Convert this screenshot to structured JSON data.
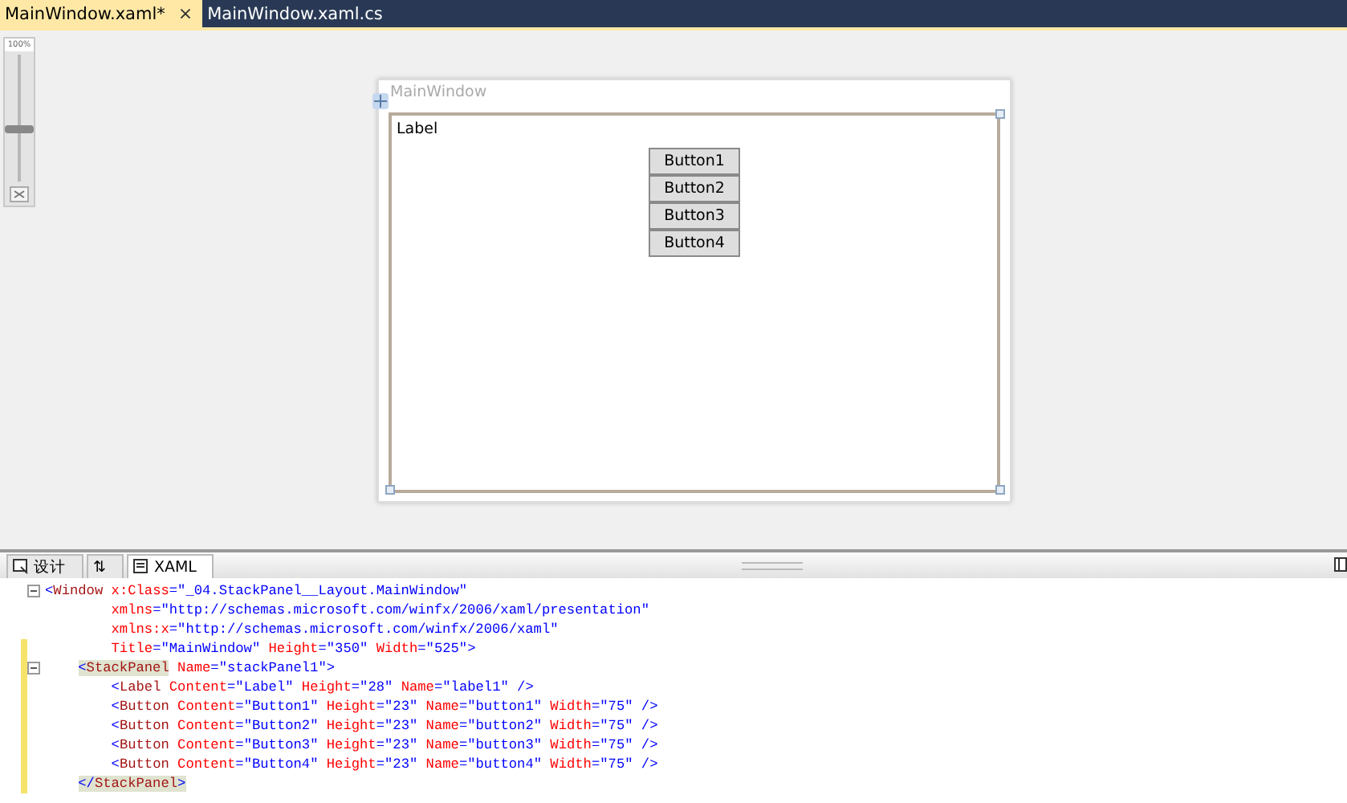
{
  "document_tabs": [
    {
      "label": "MainWindow.xaml*",
      "selected": true,
      "close": "×"
    },
    {
      "label": "MainWindow.xaml.cs",
      "selected": false
    }
  ],
  "zoom_slider": {
    "label": "100%",
    "level": 0.4
  },
  "designer": {
    "window_title": "MainWindow",
    "label": "Label",
    "buttons": [
      "Button1",
      "Button2",
      "Button3",
      "Button4"
    ]
  },
  "view_tabs": [
    {
      "label": "设计",
      "kind": "design",
      "selected": false
    },
    {
      "label": "⇅",
      "kind": "swap",
      "selected": false
    },
    {
      "label": "XAML",
      "kind": "xaml",
      "selected": true
    }
  ],
  "code": [
    {
      "collapsible": true,
      "modified": false,
      "segments": [
        {
          "kind": "punct",
          "t": "<"
        },
        {
          "kind": "tag",
          "t": "Window"
        },
        {
          "kind": "attr",
          "t": " x:Class"
        },
        {
          "kind": "punct",
          "t": "=\"_04.StackPanel__Layout.MainWindow\""
        }
      ],
      "continuation": [
        {
          "modified": false,
          "segments": [
            {
              "kind": "attr",
              "t": "xmlns"
            },
            {
              "kind": "punct",
              "t": "=\"http://schemas.microsoft.com/winfx/2006/xaml/presentation\""
            }
          ]
        },
        {
          "modified": false,
          "segments": [
            {
              "kind": "attr",
              "t": "xmlns:x"
            },
            {
              "kind": "punct",
              "t": "=\"http://schemas.microsoft.com/winfx/2006/xaml\""
            }
          ]
        },
        {
          "modified": true,
          "segments": [
            {
              "kind": "attr",
              "t": "Title"
            },
            {
              "kind": "punct",
              "t": "=\"MainWindow\""
            },
            {
              "kind": "attr",
              "t": " Height"
            },
            {
              "kind": "punct",
              "t": "=\"350\""
            },
            {
              "kind": "attr",
              "t": " Width"
            },
            {
              "kind": "punct",
              "t": "=\"525\">"
            }
          ]
        }
      ],
      "children": [
        {
          "collapsible": true,
          "modified": true,
          "segments": [
            {
              "kind": "punct",
              "t": "<",
              "highlight": true
            },
            {
              "kind": "tag",
              "t": "StackPanel",
              "highlight": true
            },
            {
              "kind": "attr",
              "t": " Name"
            },
            {
              "kind": "punct",
              "t": "=\"stackPanel1\">"
            }
          ],
          "children": [
            {
              "collapsible": false,
              "modified": true,
              "segments": [
                {
                  "kind": "punct",
                  "t": "<"
                },
                {
                  "kind": "tag",
                  "t": "Label"
                },
                {
                  "kind": "attr",
                  "t": " Content"
                },
                {
                  "kind": "punct",
                  "t": "=\"Label\""
                },
                {
                  "kind": "attr",
                  "t": " Height"
                },
                {
                  "kind": "punct",
                  "t": "=\"28\""
                },
                {
                  "kind": "attr",
                  "t": " Name"
                },
                {
                  "kind": "punct",
                  "t": "=\"label1\" />"
                }
              ]
            },
            {
              "collapsible": false,
              "modified": true,
              "segments": [
                {
                  "kind": "punct",
                  "t": "<"
                },
                {
                  "kind": "tag",
                  "t": "Button"
                },
                {
                  "kind": "attr",
                  "t": " Content"
                },
                {
                  "kind": "punct",
                  "t": "=\"Button1\""
                },
                {
                  "kind": "attr",
                  "t": " Height"
                },
                {
                  "kind": "punct",
                  "t": "=\"23\""
                },
                {
                  "kind": "attr",
                  "t": " Name"
                },
                {
                  "kind": "punct",
                  "t": "=\"button1\""
                },
                {
                  "kind": "attr",
                  "t": " Width"
                },
                {
                  "kind": "punct",
                  "t": "=\"75\" />"
                }
              ]
            },
            {
              "collapsible": false,
              "modified": true,
              "segments": [
                {
                  "kind": "punct",
                  "t": "<"
                },
                {
                  "kind": "tag",
                  "t": "Button"
                },
                {
                  "kind": "attr",
                  "t": " Content"
                },
                {
                  "kind": "punct",
                  "t": "=\"Button2\""
                },
                {
                  "kind": "attr",
                  "t": " Height"
                },
                {
                  "kind": "punct",
                  "t": "=\"23\""
                },
                {
                  "kind": "attr",
                  "t": " Name"
                },
                {
                  "kind": "punct",
                  "t": "=\"button2\""
                },
                {
                  "kind": "attr",
                  "t": " Width"
                },
                {
                  "kind": "punct",
                  "t": "=\"75\" />"
                }
              ]
            },
            {
              "collapsible": false,
              "modified": true,
              "segments": [
                {
                  "kind": "punct",
                  "t": "<"
                },
                {
                  "kind": "tag",
                  "t": "Button"
                },
                {
                  "kind": "attr",
                  "t": " Content"
                },
                {
                  "kind": "punct",
                  "t": "=\"Button3\""
                },
                {
                  "kind": "attr",
                  "t": " Height"
                },
                {
                  "kind": "punct",
                  "t": "=\"23\""
                },
                {
                  "kind": "attr",
                  "t": " Name"
                },
                {
                  "kind": "punct",
                  "t": "=\"button3\""
                },
                {
                  "kind": "attr",
                  "t": " Width"
                },
                {
                  "kind": "punct",
                  "t": "=\"75\" />"
                }
              ]
            },
            {
              "collapsible": false,
              "modified": true,
              "segments": [
                {
                  "kind": "punct",
                  "t": "<"
                },
                {
                  "kind": "tag",
                  "t": "Button"
                },
                {
                  "kind": "attr",
                  "t": " Content"
                },
                {
                  "kind": "punct",
                  "t": "=\"Button4\""
                },
                {
                  "kind": "attr",
                  "t": " Height"
                },
                {
                  "kind": "punct",
                  "t": "=\"23\""
                },
                {
                  "kind": "attr",
                  "t": " Name"
                },
                {
                  "kind": "punct",
                  "t": "=\"button4\""
                },
                {
                  "kind": "attr",
                  "t": " Width"
                },
                {
                  "kind": "punct",
                  "t": "=\"75\" />"
                }
              ]
            }
          ]
        },
        {
          "collapsible": false,
          "modified": true,
          "segments": [
            {
              "kind": "punct",
              "t": "</",
              "highlight": true
            },
            {
              "kind": "tag",
              "t": "StackPanel",
              "highlight": true
            },
            {
              "kind": "punct",
              "t": ">",
              "highlight": true
            }
          ]
        }
      ]
    }
  ]
}
